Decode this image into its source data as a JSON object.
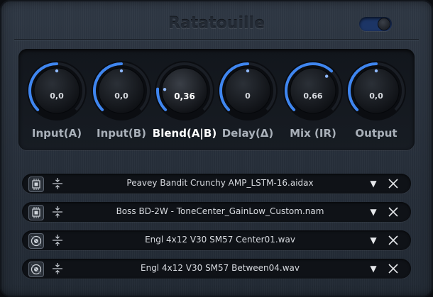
{
  "app": {
    "title": "Ratatouille",
    "power_on": true
  },
  "knobs": [
    {
      "label": "Input(A)",
      "value": "0,0",
      "level": 0.5,
      "active": false
    },
    {
      "label": "Input(B)",
      "value": "0,0",
      "level": 0.5,
      "active": false
    },
    {
      "label": "Blend(A|B)",
      "value": "0,36",
      "level": 0.18,
      "active": true
    },
    {
      "label": "Delay(Δ)",
      "value": "0",
      "level": 0.5,
      "active": false
    },
    {
      "label": "Mix (IR)",
      "value": "0,66",
      "level": 0.66,
      "active": false
    },
    {
      "label": "Output",
      "value": "0,0",
      "level": 0.5,
      "active": false
    }
  ],
  "loaders": [
    {
      "file": "Peavey Bandit Crunchy AMP_LSTM-16.aidax",
      "icon": "neural-model-icon"
    },
    {
      "file": "Boss BD-2W - ToneCenter_GainLow_Custom.nam",
      "icon": "neural-model-icon"
    },
    {
      "file": "Engl 4x12 V30 SM57 Center01.wav",
      "icon": "impulse-response-icon"
    },
    {
      "file": "Engl 4x12 V30 SM57 Between04.wav",
      "icon": "impulse-response-icon"
    }
  ],
  "colors": {
    "accent": "#3f86f0",
    "background": "#2a323d",
    "panel": "#12161c",
    "text": "#d8dbe0"
  },
  "glyphs": {
    "dropdown": "▼"
  }
}
